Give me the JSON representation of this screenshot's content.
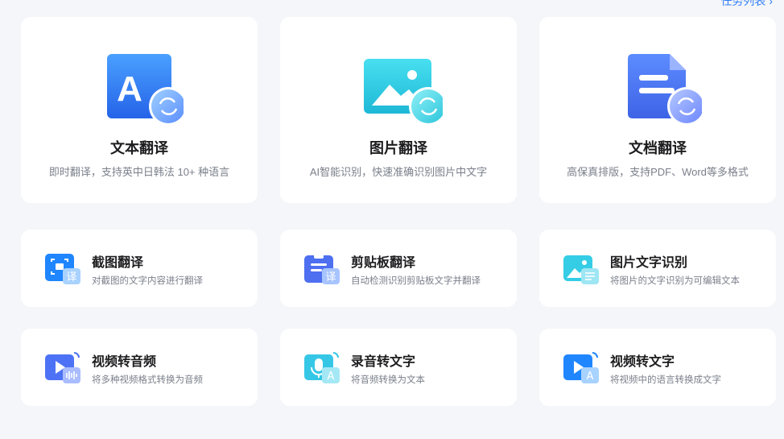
{
  "header": {
    "link_label": "任务列表 ›"
  },
  "feature_cards": [
    {
      "title": "文本翻译",
      "desc": "即时翻译，支持英中日韩法 10+ 种语言",
      "icon": "text-translate-icon"
    },
    {
      "title": "图片翻译",
      "desc": "AI智能识别，快速准确识别图片中文字",
      "icon": "image-translate-icon"
    },
    {
      "title": "文档翻译",
      "desc": "高保真排版，支持PDF、Word等多格式",
      "icon": "document-translate-icon"
    }
  ],
  "tool_cards": [
    {
      "title": "截图翻译",
      "desc": "对截图的文字内容进行翻译",
      "icon": "screenshot-translate-icon",
      "badge": "译"
    },
    {
      "title": "剪贴板翻译",
      "desc": "自动检测识别剪贴板文字并翻译",
      "icon": "clipboard-translate-icon",
      "badge": "译"
    },
    {
      "title": "图片文字识别",
      "desc": "将图片的文字识别为可编辑文本",
      "icon": "image-ocr-icon"
    },
    {
      "title": "视频转音频",
      "desc": "将多种视频格式转换为音频",
      "icon": "video-to-audio-icon"
    },
    {
      "title": "录音转文字",
      "desc": "将音频转换为文本",
      "icon": "audio-to-text-icon",
      "badge": "A"
    },
    {
      "title": "视频转文字",
      "desc": "将视频中的语言转换成文字",
      "icon": "video-to-text-icon",
      "badge": "A"
    }
  ],
  "colors": {
    "accent": "#2f7cf6",
    "card_bg": "#ffffff",
    "page_bg": "#f4f6f9"
  }
}
